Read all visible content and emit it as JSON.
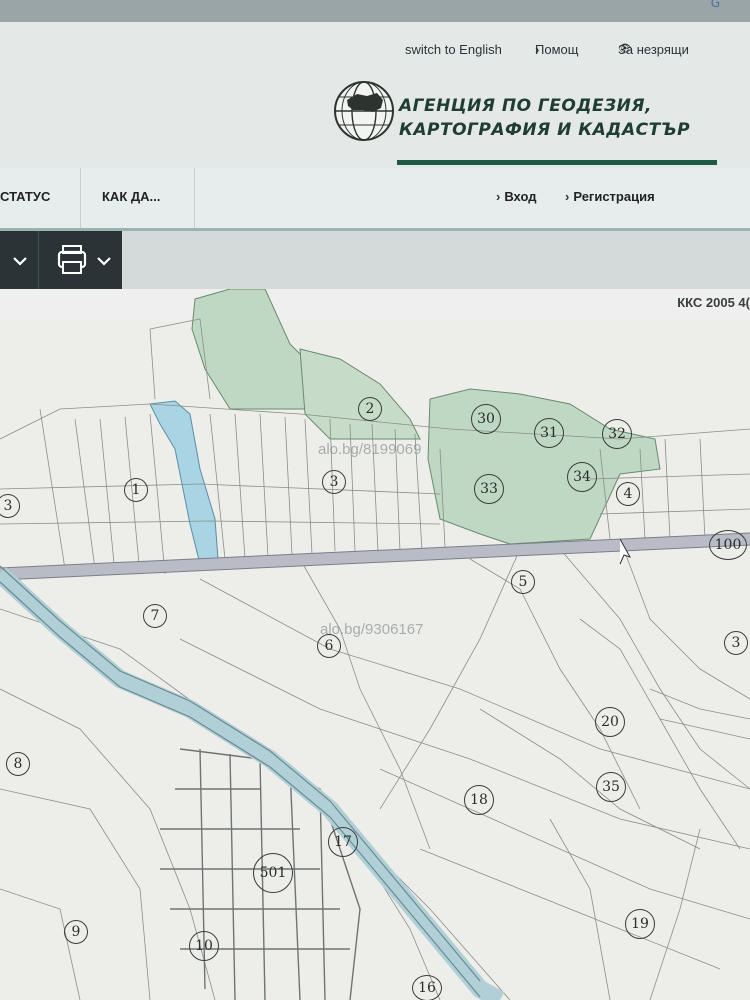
{
  "header": {
    "switch_language": "switch to English",
    "help": "Помощ",
    "accessibility": "За незрящи",
    "agency_line1": "АГЕНЦИЯ ПО ГЕОДЕЗИЯ,",
    "agency_line2": "КАРТОГРАФИЯ И КАДАСТЪР"
  },
  "nav": {
    "items": [
      {
        "label": "СТАТУС"
      },
      {
        "label": "КАК ДА..."
      }
    ],
    "login": "Вход",
    "register": "Регистрация"
  },
  "map": {
    "crs_label": "ККС 2005 4(",
    "watermarks": [
      "alo.bg/8199069",
      "alo.bg/9306167"
    ],
    "parcels": [
      "2",
      "30",
      "31",
      "32",
      "1",
      "3",
      "33",
      "34",
      "4",
      "100",
      "5",
      "7",
      "6",
      "3",
      "20",
      "8",
      "35",
      "18",
      "17",
      "501",
      "19",
      "9",
      "10",
      "16",
      "3"
    ],
    "colors": {
      "forest": "#bfd8c4",
      "road": "#b9bcc6",
      "base": "#edeee9",
      "water": "#a9d4e3"
    }
  }
}
